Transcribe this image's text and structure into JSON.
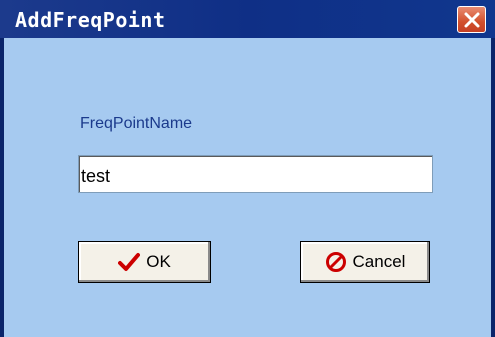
{
  "window": {
    "title": "AddFreqPoint",
    "close_icon": "close-icon"
  },
  "form": {
    "label": "FreqPointName",
    "value": "test"
  },
  "buttons": {
    "ok_label": "OK",
    "ok_icon": "checkmark-icon",
    "cancel_label": "Cancel",
    "cancel_icon": "prohibited-icon"
  },
  "colors": {
    "titlebar": "#0f2f86",
    "client": "#a6caf0",
    "close": "#d2502d",
    "ok_icon": "#cc0000",
    "cancel_icon": "#cc0000"
  }
}
